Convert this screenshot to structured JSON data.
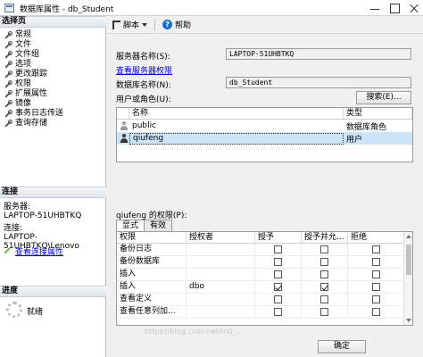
{
  "window": {
    "title": "数据库属性 - db_Student"
  },
  "left": {
    "select_page_header": "选择页",
    "pages": [
      {
        "label": "常规"
      },
      {
        "label": "文件"
      },
      {
        "label": "文件组"
      },
      {
        "label": "选项"
      },
      {
        "label": "更改跟踪"
      },
      {
        "label": "权限"
      },
      {
        "label": "扩展属性"
      },
      {
        "label": "镜像"
      },
      {
        "label": "事务日志传送"
      },
      {
        "label": "查询存储"
      }
    ],
    "connection_header": "连接",
    "server_label": "服务器:",
    "server_value": "LAPTOP-51UHBTKQ",
    "connection_label": "连接:",
    "connection_value": "LAPTOP-51UHBTKQ\\Lenovo",
    "view_connection_link": "查看连接属性",
    "progress_header": "进度",
    "progress_status": "就绪"
  },
  "toolbar": {
    "script_label": "脚本",
    "help_label": "帮助"
  },
  "form": {
    "server_name_label": "服务器名称(S):",
    "server_name_value": "LAPTOP-51UHBTKQ",
    "view_server_permissions_link": "查看服务器权限",
    "database_name_label": "数据库名称(N):",
    "database_name_value": "db_Student",
    "users_roles_label": "用户或角色(U):",
    "search_button": "搜索(E)..."
  },
  "users_grid": {
    "columns": [
      "名称",
      "类型"
    ],
    "rows": [
      {
        "name": "public",
        "type": "数据库角色",
        "icon": "role-icon"
      },
      {
        "name": "qiufeng",
        "type": "用户",
        "icon": "user-icon"
      }
    ]
  },
  "permissions": {
    "title": "qiufeng 的权限(P):",
    "tabs": [
      "显式",
      "有效"
    ],
    "columns": [
      "权限",
      "授权者",
      "授予",
      "授予并允...",
      "拒绝"
    ],
    "rows": [
      {
        "permission": "备份日志",
        "grantor": "",
        "grant": false,
        "with_grant": false,
        "deny": false
      },
      {
        "permission": "备份数据库",
        "grantor": "",
        "grant": false,
        "with_grant": false,
        "deny": false
      },
      {
        "permission": "插入",
        "grantor": "",
        "grant": false,
        "with_grant": false,
        "deny": false
      },
      {
        "permission": "插入",
        "grantor": "dbo",
        "grant": true,
        "with_grant": true,
        "deny": false
      },
      {
        "permission": "查看定义",
        "grantor": "",
        "grant": false,
        "with_grant": false,
        "deny": false
      },
      {
        "permission": "查看任意列加...",
        "grantor": "",
        "grant": false,
        "with_grant": false,
        "deny": false
      }
    ]
  },
  "footer": {
    "ok_button": "确定",
    "watermark": "https://blog.csdn.net/m0_..."
  }
}
